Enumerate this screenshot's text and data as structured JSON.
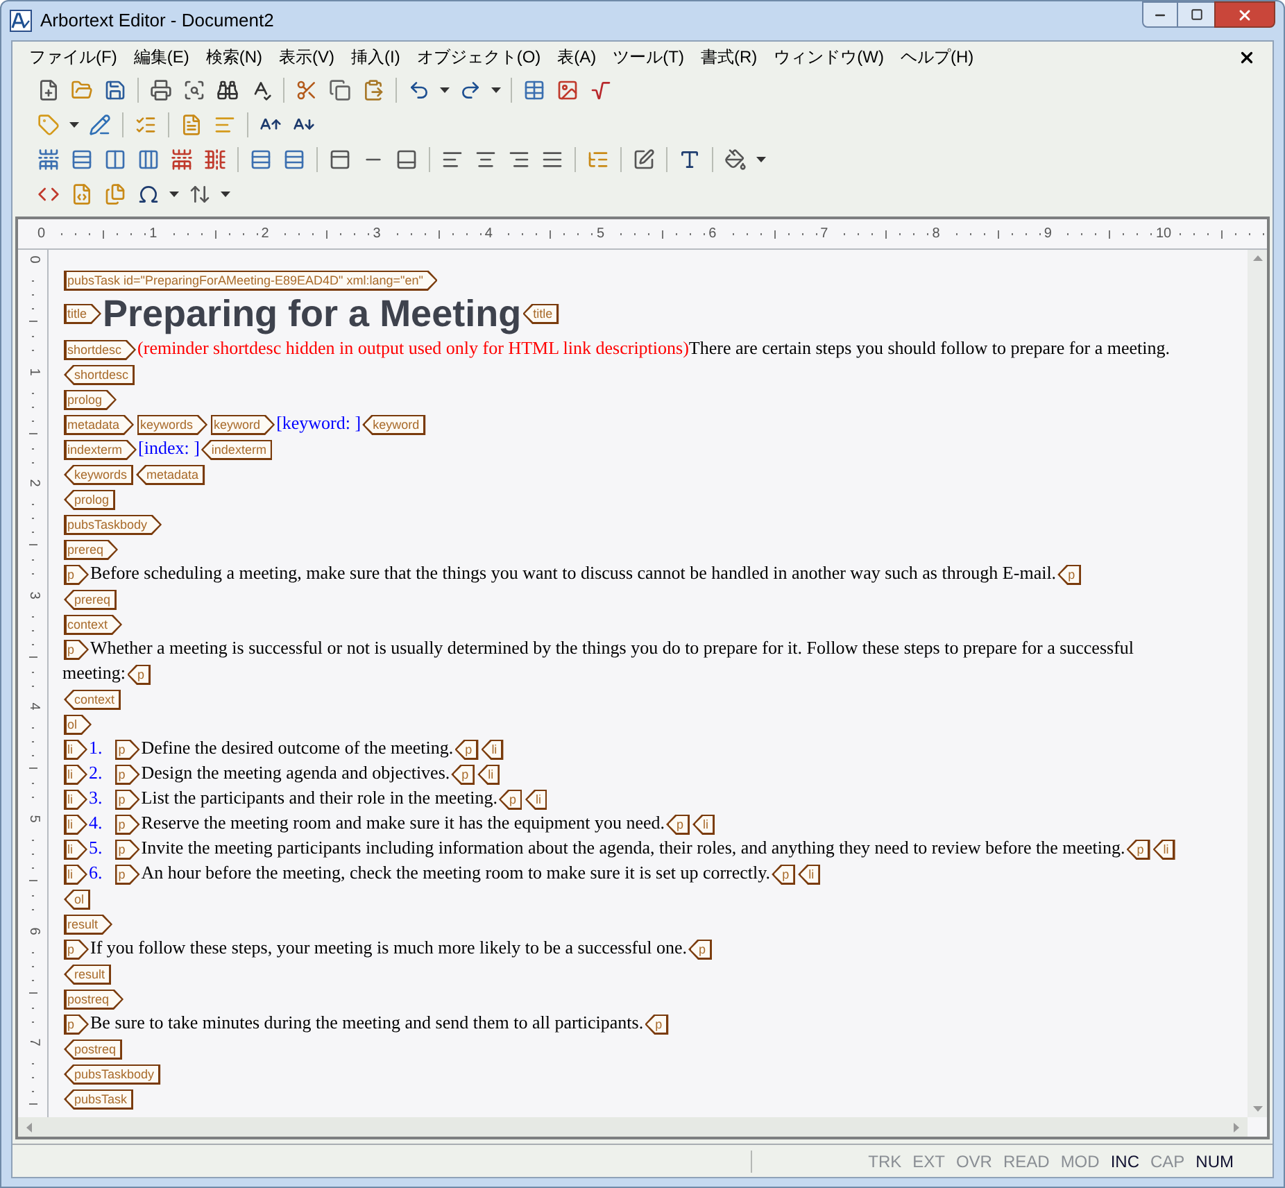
{
  "window": {
    "title": "Arbortext Editor - Document2"
  },
  "menu": [
    "ファイル(F)",
    "編集(E)",
    "検索(N)",
    "表示(V)",
    "挿入(I)",
    "オブジェクト(O)",
    "表(A)",
    "ツール(T)",
    "書式(R)",
    "ウィンドウ(W)",
    "ヘルプ(H)"
  ],
  "ruler": {
    "horizontal": [
      "0",
      "1",
      "2",
      "3",
      "4",
      "5",
      "6",
      "7",
      "8",
      "9",
      "10"
    ],
    "vertical": [
      "0",
      "1",
      "2",
      "3",
      "4",
      "5",
      "6",
      "7"
    ]
  },
  "document": {
    "lines": [
      {
        "segments": [
          {
            "kind": "open",
            "text": "pubsTask id=\"PreparingForAMeeting-E89EAD4D\" xml:lang=\"en\""
          }
        ]
      },
      {
        "segments": [
          {
            "kind": "open",
            "text": "title"
          },
          {
            "kind": "title",
            "text": "Preparing for a Meeting"
          },
          {
            "kind": "close",
            "text": "title"
          }
        ]
      },
      {
        "segments": [
          {
            "kind": "open",
            "text": "shortdesc"
          },
          {
            "kind": "hidden",
            "text": "(reminder shortdesc hidden in output used only for HTML link descriptions)"
          },
          {
            "kind": "text",
            "text": "There are certain steps you should follow to prepare for a meeting."
          }
        ]
      },
      {
        "segments": [
          {
            "kind": "close",
            "text": "shortdesc"
          }
        ]
      },
      {
        "segments": [
          {
            "kind": "open",
            "text": "prolog"
          }
        ]
      },
      {
        "segments": [
          {
            "kind": "open",
            "text": "metadata"
          },
          {
            "kind": "open",
            "text": "keywords"
          },
          {
            "kind": "open",
            "text": "keyword"
          },
          {
            "kind": "placeholder",
            "text": "[keyword: ]"
          },
          {
            "kind": "close",
            "text": "keyword"
          }
        ]
      },
      {
        "segments": [
          {
            "kind": "open",
            "text": "indexterm"
          },
          {
            "kind": "placeholder",
            "text": "[index: ]"
          },
          {
            "kind": "close",
            "text": "indexterm"
          }
        ]
      },
      {
        "segments": [
          {
            "kind": "close",
            "text": "keywords"
          },
          {
            "kind": "close",
            "text": "metadata"
          }
        ]
      },
      {
        "segments": [
          {
            "kind": "close",
            "text": "prolog"
          }
        ]
      },
      {
        "segments": [
          {
            "kind": "open",
            "text": "pubsTaskbody"
          }
        ]
      },
      {
        "segments": [
          {
            "kind": "open",
            "text": "prereq"
          }
        ]
      },
      {
        "segments": [
          {
            "kind": "open",
            "text": "p"
          },
          {
            "kind": "text",
            "text": "Before scheduling a meeting, make sure that the things you want to discuss cannot be handled in another way such as through E-mail."
          },
          {
            "kind": "close",
            "text": "p"
          }
        ]
      },
      {
        "segments": [
          {
            "kind": "close",
            "text": "prereq"
          }
        ]
      },
      {
        "segments": [
          {
            "kind": "open",
            "text": "context"
          }
        ]
      },
      {
        "segments": [
          {
            "kind": "open",
            "text": "p"
          },
          {
            "kind": "text",
            "text": "Whether a meeting is successful or not is usually determined by the things you do to prepare for it. Follow these steps to prepare for a successful"
          }
        ]
      },
      {
        "segments": [
          {
            "kind": "text",
            "text": "meeting:"
          },
          {
            "kind": "close",
            "text": "p"
          }
        ]
      },
      {
        "segments": [
          {
            "kind": "close",
            "text": "context"
          }
        ]
      },
      {
        "segments": [
          {
            "kind": "open",
            "text": "ol"
          }
        ]
      },
      {
        "segments": [
          {
            "kind": "open",
            "text": "li"
          },
          {
            "kind": "number",
            "text": "1."
          },
          {
            "kind": "open",
            "text": "p"
          },
          {
            "kind": "text",
            "text": "Define the desired outcome of the meeting."
          },
          {
            "kind": "close",
            "text": "p"
          },
          {
            "kind": "close",
            "text": "li"
          }
        ]
      },
      {
        "segments": [
          {
            "kind": "open",
            "text": "li"
          },
          {
            "kind": "number",
            "text": "2."
          },
          {
            "kind": "open",
            "text": "p"
          },
          {
            "kind": "text",
            "text": "Design the meeting agenda and objectives."
          },
          {
            "kind": "close",
            "text": "p"
          },
          {
            "kind": "close",
            "text": "li"
          }
        ]
      },
      {
        "segments": [
          {
            "kind": "open",
            "text": "li"
          },
          {
            "kind": "number",
            "text": "3."
          },
          {
            "kind": "open",
            "text": "p"
          },
          {
            "kind": "text",
            "text": "List the participants and their role in the meeting."
          },
          {
            "kind": "close",
            "text": "p"
          },
          {
            "kind": "close",
            "text": "li"
          }
        ]
      },
      {
        "segments": [
          {
            "kind": "open",
            "text": "li"
          },
          {
            "kind": "number",
            "text": "4."
          },
          {
            "kind": "open",
            "text": "p"
          },
          {
            "kind": "text",
            "text": "Reserve the meeting room and make sure it has the equipment you need."
          },
          {
            "kind": "close",
            "text": "p"
          },
          {
            "kind": "close",
            "text": "li"
          }
        ]
      },
      {
        "segments": [
          {
            "kind": "open",
            "text": "li"
          },
          {
            "kind": "number",
            "text": "5."
          },
          {
            "kind": "open",
            "text": "p"
          },
          {
            "kind": "text",
            "text": "Invite the meeting participants including information about the agenda, their roles, and anything they need to review before the meeting."
          },
          {
            "kind": "close",
            "text": "p"
          },
          {
            "kind": "close",
            "text": "li"
          }
        ]
      },
      {
        "segments": [
          {
            "kind": "open",
            "text": "li"
          },
          {
            "kind": "number",
            "text": "6."
          },
          {
            "kind": "open",
            "text": "p"
          },
          {
            "kind": "text",
            "text": "An hour before the meeting, check the meeting room to make sure it is set up correctly."
          },
          {
            "kind": "close",
            "text": "p"
          },
          {
            "kind": "close",
            "text": "li"
          }
        ]
      },
      {
        "segments": [
          {
            "kind": "close",
            "text": "ol"
          }
        ]
      },
      {
        "segments": [
          {
            "kind": "open",
            "text": "result"
          }
        ]
      },
      {
        "segments": [
          {
            "kind": "open",
            "text": "p"
          },
          {
            "kind": "text",
            "text": "If you follow these steps, your meeting is much more likely to be a successful one."
          },
          {
            "kind": "close",
            "text": "p"
          }
        ]
      },
      {
        "segments": [
          {
            "kind": "close",
            "text": "result"
          }
        ]
      },
      {
        "segments": [
          {
            "kind": "open",
            "text": "postreq"
          }
        ]
      },
      {
        "segments": [
          {
            "kind": "open",
            "text": "p"
          },
          {
            "kind": "text",
            "text": "Be sure to take minutes during the meeting and send them to all participants."
          },
          {
            "kind": "close",
            "text": "p"
          }
        ]
      },
      {
        "segments": [
          {
            "kind": "close",
            "text": "postreq"
          }
        ]
      },
      {
        "segments": [
          {
            "kind": "close",
            "text": "pubsTaskbody"
          }
        ]
      },
      {
        "segments": [
          {
            "kind": "close",
            "text": "pubsTask"
          }
        ]
      }
    ]
  },
  "status_bar": {
    "indicators": [
      {
        "label": "TRK",
        "on": false
      },
      {
        "label": "EXT",
        "on": false
      },
      {
        "label": "OVR",
        "on": false
      },
      {
        "label": "READ",
        "on": false
      },
      {
        "label": "MOD",
        "on": false
      },
      {
        "label": "INC",
        "on": true
      },
      {
        "label": "CAP",
        "on": false
      },
      {
        "label": "NUM",
        "on": true
      }
    ]
  }
}
